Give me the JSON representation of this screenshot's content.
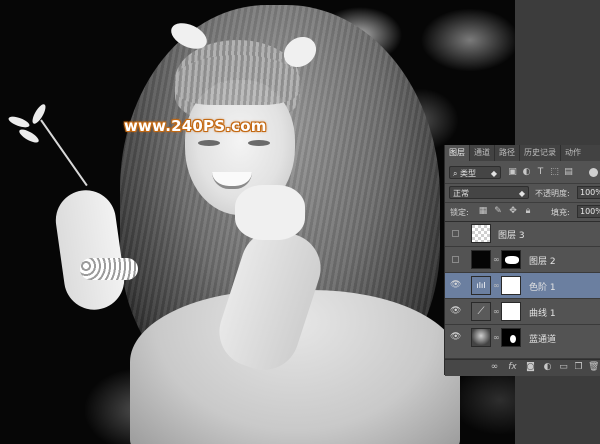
{
  "watermark": {
    "text": "www.240PS.com"
  },
  "layers_panel": {
    "tabs": [
      {
        "label": "图层",
        "active": true
      },
      {
        "label": "通道",
        "active": false
      },
      {
        "label": "路径",
        "active": false
      },
      {
        "label": "历史记录",
        "active": false
      },
      {
        "label": "动作",
        "active": false
      }
    ],
    "filter": {
      "kind_label": "类型",
      "search_icon": "search-icon",
      "filter_icons": [
        "image-filter-icon",
        "adjustment-filter-icon",
        "type-filter-icon",
        "shape-filter-icon",
        "smart-object-filter-icon"
      ]
    },
    "blend_mode": "正常",
    "opacity_label": "不透明度:",
    "opacity_value": "100%",
    "lock_label": "锁定:",
    "fill_label": "填充:",
    "fill_value": "100%",
    "layers": [
      {
        "name": "图层 3",
        "visible": false,
        "selected": false,
        "thumb": "transparent-checker",
        "mask": false
      },
      {
        "name": "图层 2",
        "visible": false,
        "selected": false,
        "thumb": "black",
        "mask": true
      },
      {
        "name": "色阶 1",
        "visible": true,
        "selected": true,
        "thumb": "levels-adjustment",
        "mask": true
      },
      {
        "name": "曲线 1",
        "visible": true,
        "selected": false,
        "thumb": "curves-adjustment",
        "mask": true
      },
      {
        "name": "蓝通道",
        "visible": true,
        "selected": false,
        "thumb": "photo",
        "mask": true
      }
    ],
    "bottom_icons": [
      "link-icon",
      "fx-icon",
      "add-mask-icon",
      "adjustment-layer-icon",
      "group-folder-icon",
      "new-layer-icon",
      "trash-icon"
    ]
  },
  "colors": {
    "panel_bg": "#535353",
    "selected_layer": "#6b7fa0",
    "watermark_stroke": "#c46a14"
  }
}
